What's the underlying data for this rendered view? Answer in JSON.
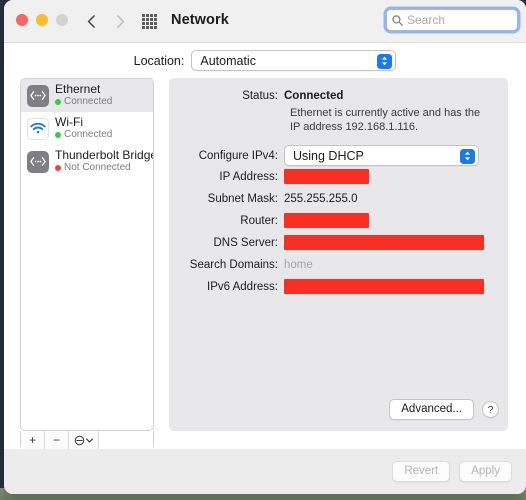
{
  "window": {
    "title": "Network",
    "traffic_lights": [
      "close",
      "minimize",
      "zoom"
    ],
    "nav_back_icon": "chevron-left-icon",
    "nav_forward_icon": "chevron-right-icon",
    "grid_icon": "grid-icon"
  },
  "search": {
    "value": "",
    "placeholder": "Search",
    "icon": "search-icon"
  },
  "location": {
    "label": "Location:",
    "value": "Automatic"
  },
  "sidebar": {
    "interfaces": [
      {
        "name": "Ethernet",
        "status": "Connected",
        "state": "connected",
        "icon": "ethernet-icon",
        "selected": true
      },
      {
        "name": "Wi-Fi",
        "status": "Connected",
        "state": "connected",
        "icon": "wifi-icon",
        "selected": false
      },
      {
        "name": "Thunderbolt Bridge",
        "status": "Not Connected",
        "state": "disconnected",
        "icon": "ethernet-icon",
        "selected": false
      }
    ],
    "footer": {
      "add_label": "+",
      "remove_label": "−",
      "action_icon": "gear-icon",
      "action_chevron_icon": "chevron-down-icon"
    }
  },
  "detail": {
    "status_label": "Status:",
    "status_value": "Connected",
    "status_description": "Ethernet is currently active and has the IP address 192.168.1.116.",
    "configure_ipv4_label": "Configure IPv4:",
    "configure_ipv4_value": "Using DHCP",
    "fields": [
      {
        "label": "IP Address:",
        "value": "",
        "redacted": true,
        "width": "short"
      },
      {
        "label": "Subnet Mask:",
        "value": "255.255.255.0",
        "redacted": false,
        "muted": false
      },
      {
        "label": "Router:",
        "value": "",
        "redacted": true,
        "width": "short"
      },
      {
        "label": "DNS Server:",
        "value": "",
        "redacted": true,
        "width": "long"
      },
      {
        "label": "Search Domains:",
        "value": "home",
        "redacted": false,
        "muted": true
      },
      {
        "label": "IPv6 Address:",
        "value": "",
        "redacted": true,
        "width": "long"
      }
    ],
    "advanced_label": "Advanced...",
    "help_label": "?"
  },
  "bottom": {
    "revert_label": "Revert",
    "apply_label": "Apply"
  },
  "colors": {
    "accent": "#1a7aeb",
    "redaction": "#fa2f23",
    "connected": "#38c84a",
    "disconnected": "#f3433a",
    "focus_ring": "#4e94ff"
  }
}
